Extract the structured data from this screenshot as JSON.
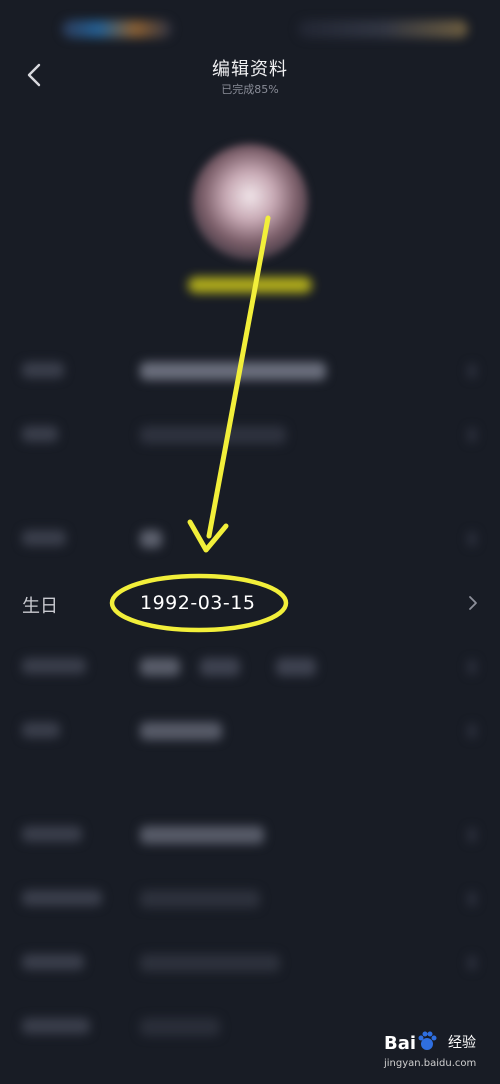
{
  "header": {
    "title": "编辑资料",
    "subtitle": "已完成85%"
  },
  "birthday": {
    "label": "生日",
    "value": "1992-03-15"
  },
  "watermark": {
    "brand": "Bai",
    "brand_suffix": "经验",
    "url": "jingyan.baidu.com"
  },
  "icons": {
    "back": "chevron-left-icon",
    "next": "chevron-right-icon",
    "annotation": "arrow-icon"
  },
  "colors": {
    "background": "#181c25",
    "highlight": "#f2ef3a"
  }
}
